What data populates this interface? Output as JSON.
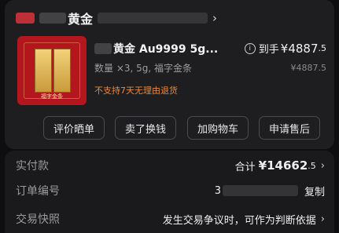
{
  "shop": {
    "name": "黄金",
    "chevron": "›"
  },
  "product": {
    "title": "黄金 Au9999 5g...",
    "spec": "数量 ×3, 5g, 福字金条",
    "return_policy": "不支持7天无理由退货",
    "thumbnail_caption": "福字金条",
    "paid_label": "到手",
    "paid_amount": "¥4887",
    "paid_decimal": ".5",
    "original_price": "¥4887.5",
    "info_icon": "i"
  },
  "actions": {
    "review": "评价晒单",
    "sell_exchange": "卖了换钱",
    "add_to_cart": "加购物车",
    "after_sales": "申请售后"
  },
  "details": {
    "paid_row_label": "实付款",
    "total_label": "合计",
    "total_amount": "¥14662",
    "total_decimal": ".5",
    "order_number_label": "订单编号",
    "order_number_prefix": "3",
    "copy_label": "复制",
    "snapshot_label": "交易快照",
    "snapshot_text": "发生交易争议时，可作为判断依据",
    "chevron": "›"
  },
  "colors": {
    "background": "#0e0e10",
    "card": "#1e1e20",
    "warning": "#e58a3a",
    "muted_text": "#9c9c9c"
  }
}
